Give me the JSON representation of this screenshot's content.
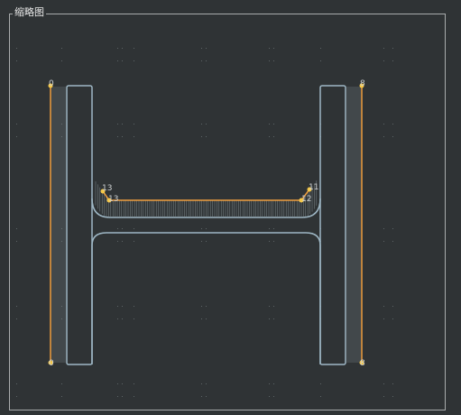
{
  "panel": {
    "title": "缩略图"
  },
  "colors": {
    "background": "#2f3335",
    "outline": "#9fb8c6",
    "path": "#f0a040",
    "point": "#f5c84a",
    "hatch": "#7f8a8e",
    "dots": "#5d6466"
  },
  "points": [
    {
      "id": "p0a",
      "label": "0"
    },
    {
      "id": "p0b",
      "label": "0"
    },
    {
      "id": "p8a",
      "label": "8"
    },
    {
      "id": "p8b",
      "label": "8"
    },
    {
      "id": "p13a",
      "label": "13"
    },
    {
      "id": "p13b",
      "label": "13"
    },
    {
      "id": "p11",
      "label": "11"
    },
    {
      "id": "p12",
      "label": "12"
    }
  ]
}
